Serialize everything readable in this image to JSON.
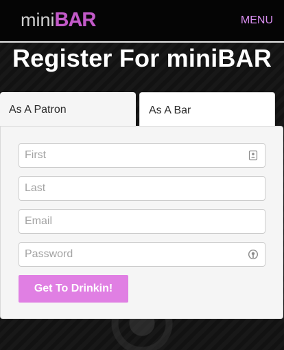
{
  "header": {
    "logo_mini": "mini",
    "logo_bar": "BAR",
    "menu_label": "MENU"
  },
  "page_title": "Register For miniBAR",
  "tabs": [
    {
      "label": "As A Patron",
      "active": true
    },
    {
      "label": "As A Bar",
      "active": false
    }
  ],
  "form": {
    "first_placeholder": "First",
    "first_value": "",
    "last_placeholder": "Last",
    "last_value": "",
    "email_placeholder": "Email",
    "email_value": "",
    "password_placeholder": "Password",
    "password_value": "",
    "submit_label": "Get To Drinkin!"
  },
  "icons": {
    "first_field_icon": "contact-card-icon",
    "password_field_icon": "password-manager-key-icon"
  },
  "colors": {
    "accent": "#e07fe3",
    "menu": "#d98ef0",
    "logo_bar": "#c25ac8",
    "header_bg": "#050505"
  }
}
